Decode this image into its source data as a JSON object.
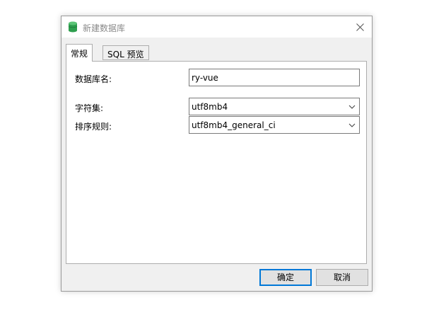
{
  "window": {
    "title": "新建数据库",
    "icon": "database-icon",
    "close_icon": "close-icon"
  },
  "tabs": [
    {
      "label": "常规",
      "active": true
    },
    {
      "label": "SQL 预览",
      "active": false
    }
  ],
  "form": {
    "db_name": {
      "label": "数据库名:",
      "value": "ry-vue"
    },
    "charset": {
      "label": "字符集:",
      "value": "utf8mb4"
    },
    "collation": {
      "label": "排序规则:",
      "value": "utf8mb4_general_ci"
    }
  },
  "buttons": {
    "ok": "确定",
    "cancel": "取消"
  },
  "colors": {
    "accent": "#0078d7",
    "icon_green": "#2e9e4e"
  }
}
